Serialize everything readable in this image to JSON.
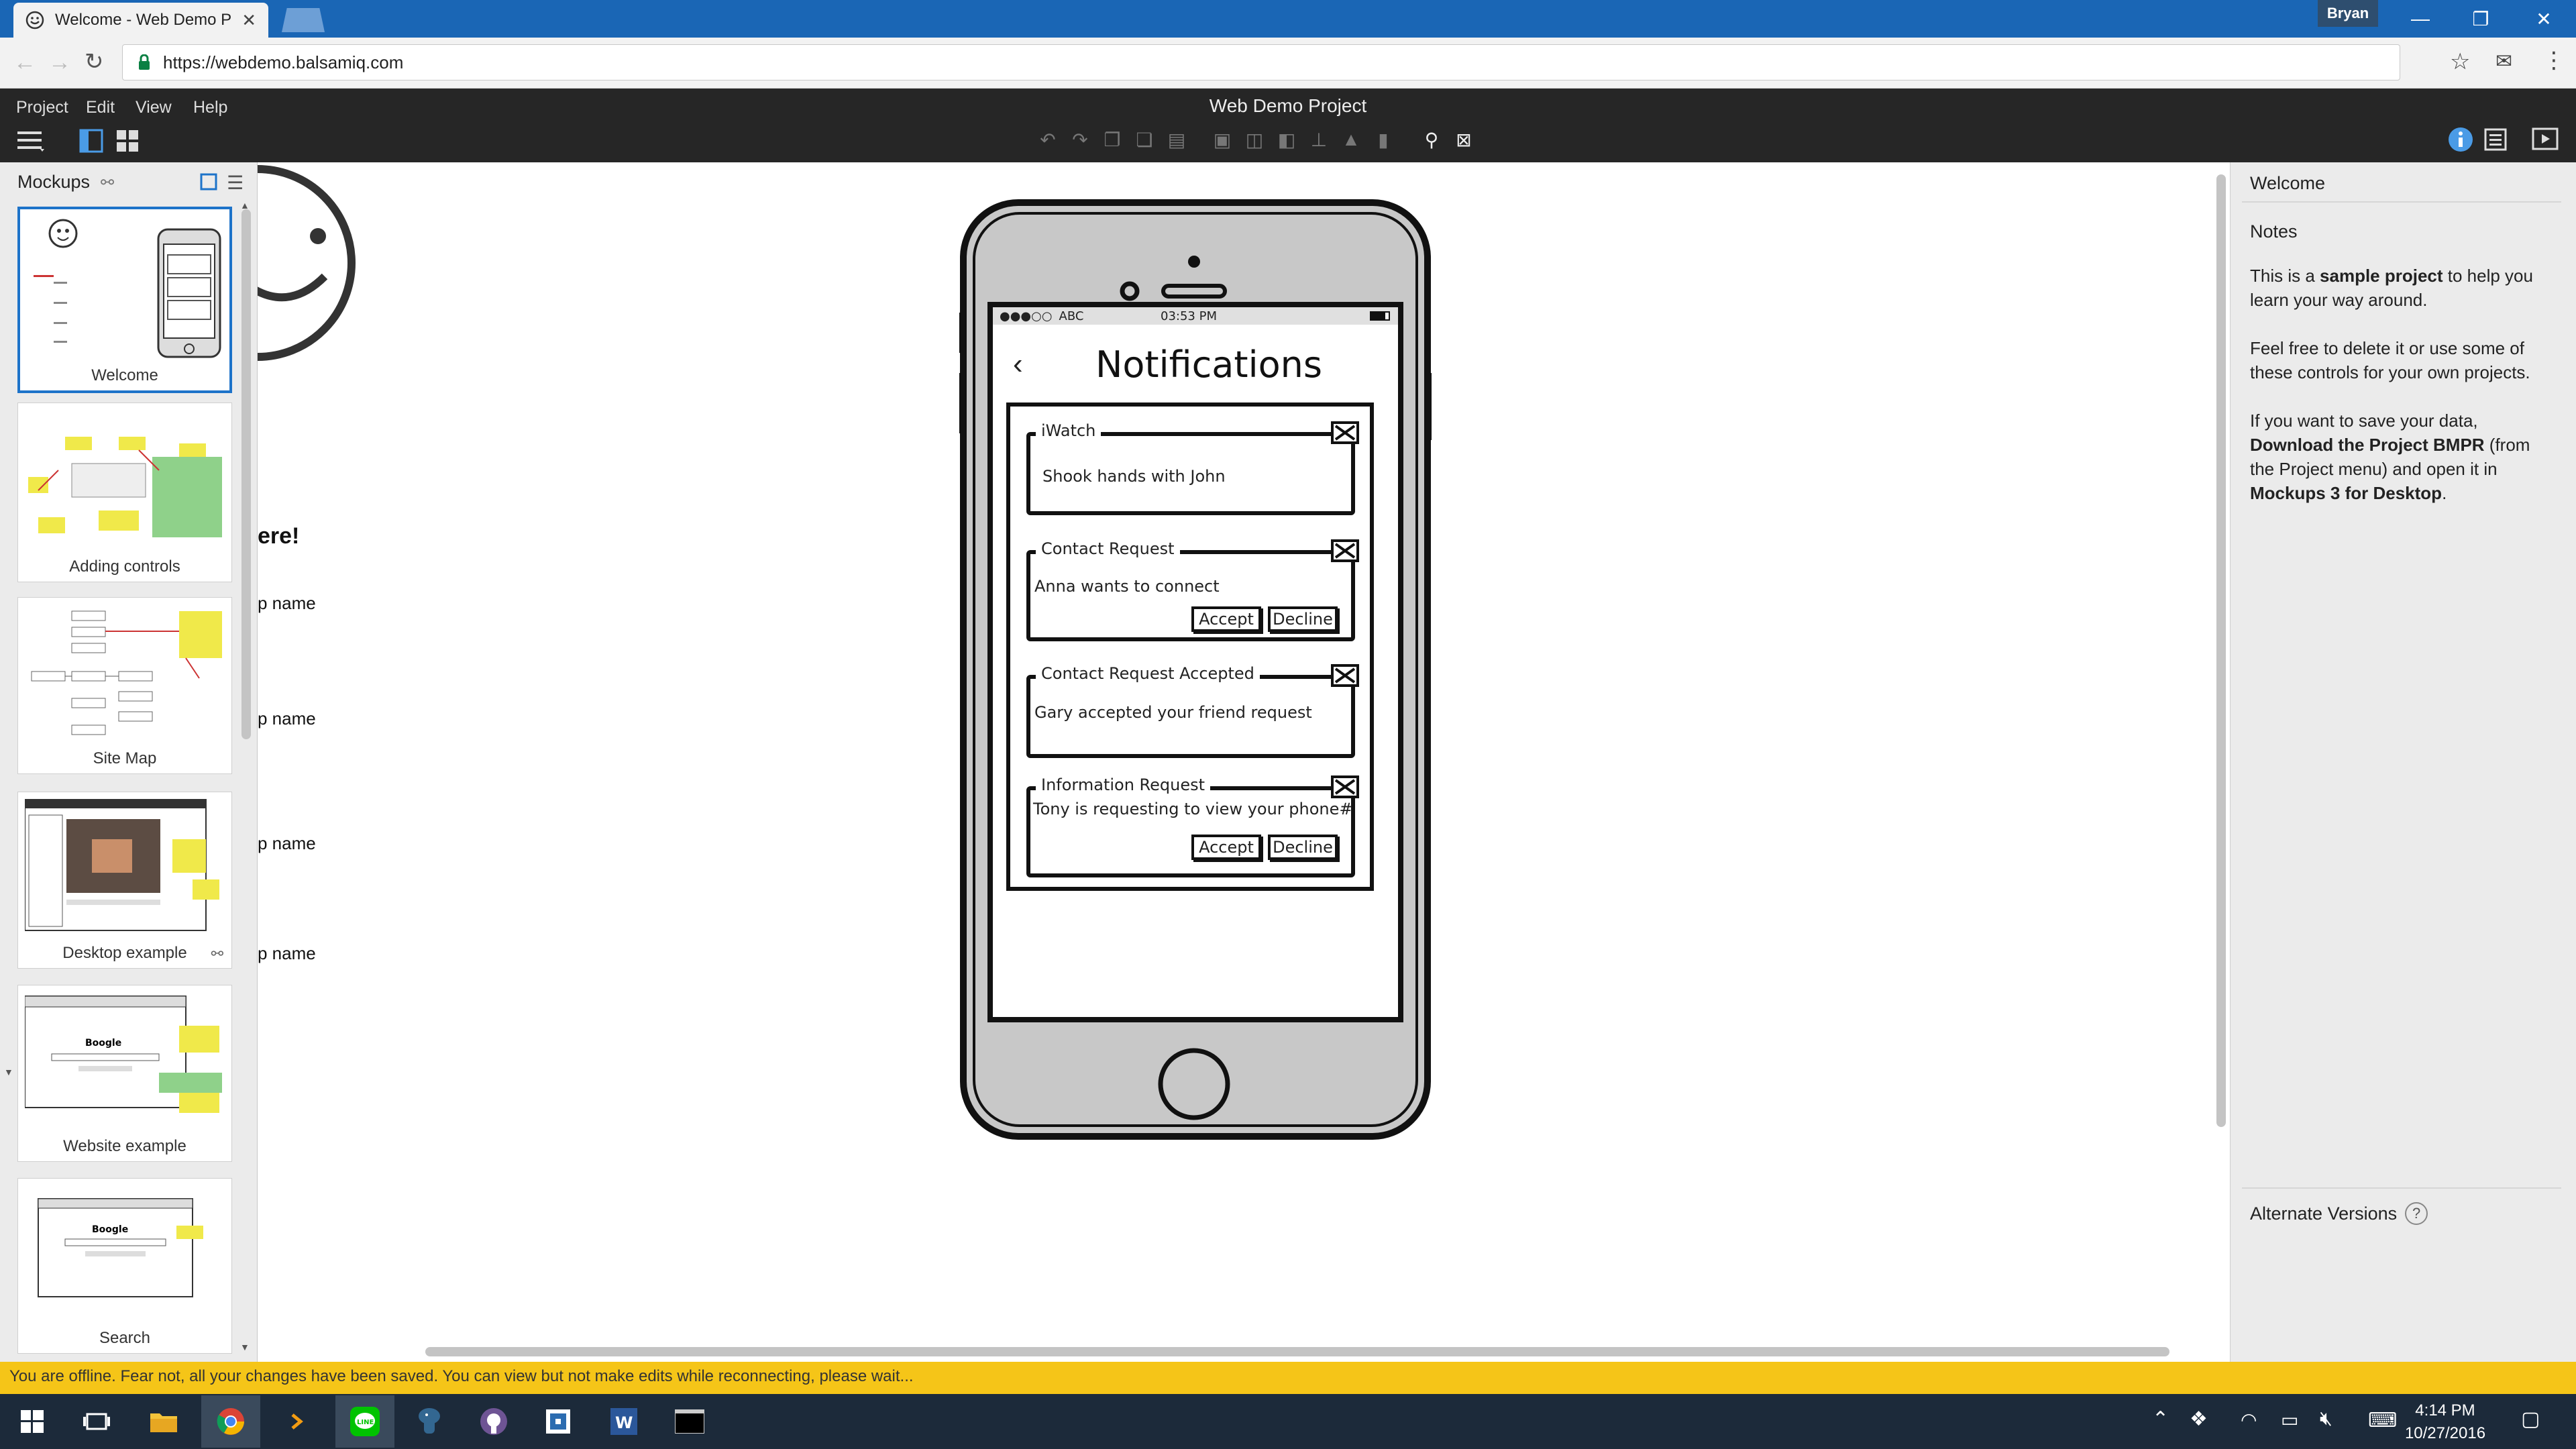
{
  "browser": {
    "tab_title": "Welcome - Web Demo P",
    "url": "https://webdemo.balsamiq.com",
    "user": "Bryan"
  },
  "app": {
    "title": "Web Demo Project",
    "menus": [
      "Project",
      "Edit",
      "View",
      "Help"
    ]
  },
  "mockups_panel": {
    "header": "Mockups",
    "items": [
      {
        "label": "Welcome",
        "selected": true
      },
      {
        "label": "Adding controls",
        "selected": false
      },
      {
        "label": "Site Map",
        "selected": false
      },
      {
        "label": "Desktop example",
        "selected": false
      },
      {
        "label": "Website example",
        "selected": false
      },
      {
        "label": "Search",
        "selected": false
      }
    ]
  },
  "canvas": {
    "partial_heading": "ere!",
    "partial_labels": [
      "p name",
      "p name",
      "p name",
      "p name"
    ],
    "phone": {
      "carrier": "ABC",
      "time": "03:53 PM",
      "screen_title": "Notifications",
      "notifications": [
        {
          "title": "iWatch",
          "body": "Shook hands with John",
          "buttons": []
        },
        {
          "title": "Contact Request",
          "body": "Anna wants to connect",
          "buttons": [
            "Accept",
            "Decline"
          ]
        },
        {
          "title": "Contact Request Accepted",
          "body": "Gary accepted your friend request",
          "buttons": []
        },
        {
          "title": "Information Request",
          "body": "Tony is requesting to view your phone#",
          "buttons": [
            "Accept",
            "Decline"
          ]
        }
      ]
    }
  },
  "right_panel": {
    "title": "Welcome",
    "notes_label": "Notes",
    "p1_a": "This is a ",
    "p1_b": "sample project",
    "p1_c": " to help you learn your way around.",
    "p2": "Feel free to delete it or use some of these controls for your own projects.",
    "p3_a": "If you want to save your data, ",
    "p3_b": "Download the Project BMPR",
    "p3_c": " (from the Project menu) and open it in ",
    "p3_d": "Mockups 3 for Desktop",
    "p3_e": ".",
    "alternate_versions": "Alternate Versions",
    "help_glyph": "?"
  },
  "status_bar": {
    "message": "You are offline. Fear not, all your changes have been saved. You can view but not make edits while reconnecting, please wait..."
  },
  "taskbar": {
    "time": "4:14 PM",
    "date": "10/27/2016"
  },
  "colors": {
    "titlebar": "#1a66b5",
    "appbar": "#262626",
    "selection": "#1d73c9",
    "status_bar": "#f5c518",
    "taskbar": "#1c2a3a"
  }
}
